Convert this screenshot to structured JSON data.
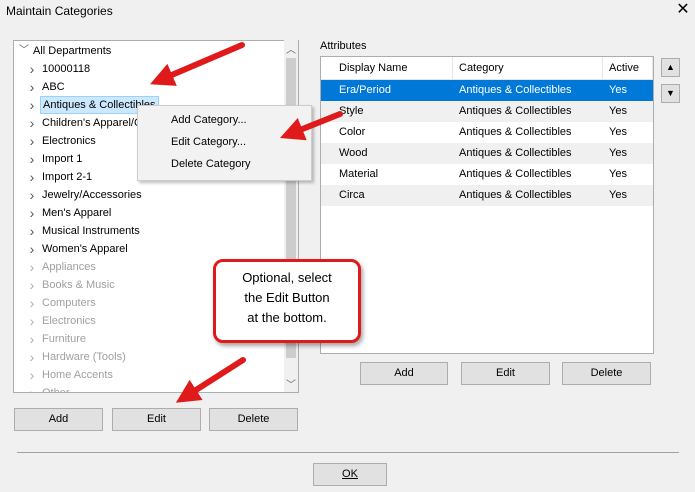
{
  "window": {
    "title": "Maintain Categories",
    "close_symbol": "✕"
  },
  "tree": {
    "root_label": "All Departments",
    "items": [
      {
        "label": "10000118",
        "disabled": false
      },
      {
        "label": "ABC",
        "disabled": false
      },
      {
        "label": "Antiques & Collectibles",
        "disabled": false,
        "selected": true
      },
      {
        "label": "Children's Apparel/C",
        "disabled": false
      },
      {
        "label": "Electronics",
        "disabled": false
      },
      {
        "label": "Import 1",
        "disabled": false
      },
      {
        "label": "Import 2-1",
        "disabled": false
      },
      {
        "label": "Jewelry/Accessories",
        "disabled": false
      },
      {
        "label": "Men's Apparel",
        "disabled": false
      },
      {
        "label": "Musical Instruments",
        "disabled": false
      },
      {
        "label": "Women's Apparel",
        "disabled": false
      },
      {
        "label": "Appliances",
        "disabled": true
      },
      {
        "label": "Books & Music",
        "disabled": true
      },
      {
        "label": "Computers",
        "disabled": true
      },
      {
        "label": "Electronics",
        "disabled": true
      },
      {
        "label": "Furniture",
        "disabled": true
      },
      {
        "label": "Hardware (Tools)",
        "disabled": true
      },
      {
        "label": "Home Accents",
        "disabled": true
      },
      {
        "label": "Other",
        "disabled": true
      }
    ]
  },
  "left_buttons": {
    "add": "Add",
    "edit": "Edit",
    "delete": "Delete"
  },
  "context_menu": {
    "items": [
      "Add Category...",
      "Edit Category...",
      "Delete Category"
    ]
  },
  "attributes": {
    "label": "Attributes",
    "columns": [
      "Display Name",
      "Category",
      "Active"
    ],
    "rows": [
      [
        "Era/Period",
        "Antiques & Collectibles",
        "Yes"
      ],
      [
        "Style",
        "Antiques & Collectibles",
        "Yes"
      ],
      [
        "Color",
        "Antiques & Collectibles",
        "Yes"
      ],
      [
        "Wood",
        "Antiques & Collectibles",
        "Yes"
      ],
      [
        "Material",
        "Antiques & Collectibles",
        "Yes"
      ],
      [
        "Circa",
        "Antiques & Collectibles",
        "Yes"
      ]
    ],
    "selected_row": 0
  },
  "right_buttons": {
    "add": "Add",
    "edit": "Edit",
    "delete": "Delete"
  },
  "ok_button": "OK",
  "callout": {
    "lines": [
      "Optional, select",
      "the Edit Button",
      "at the bottom."
    ]
  },
  "colors": {
    "selection": "#0078d7",
    "annotation_red": "#e01a1a",
    "tree_highlight": "#cce8ff"
  },
  "icons": {
    "expand": "chevron-right-icon",
    "collapse": "chevron-down-icon",
    "move_up": "triangle-up-icon",
    "move_down": "triangle-down-icon"
  }
}
